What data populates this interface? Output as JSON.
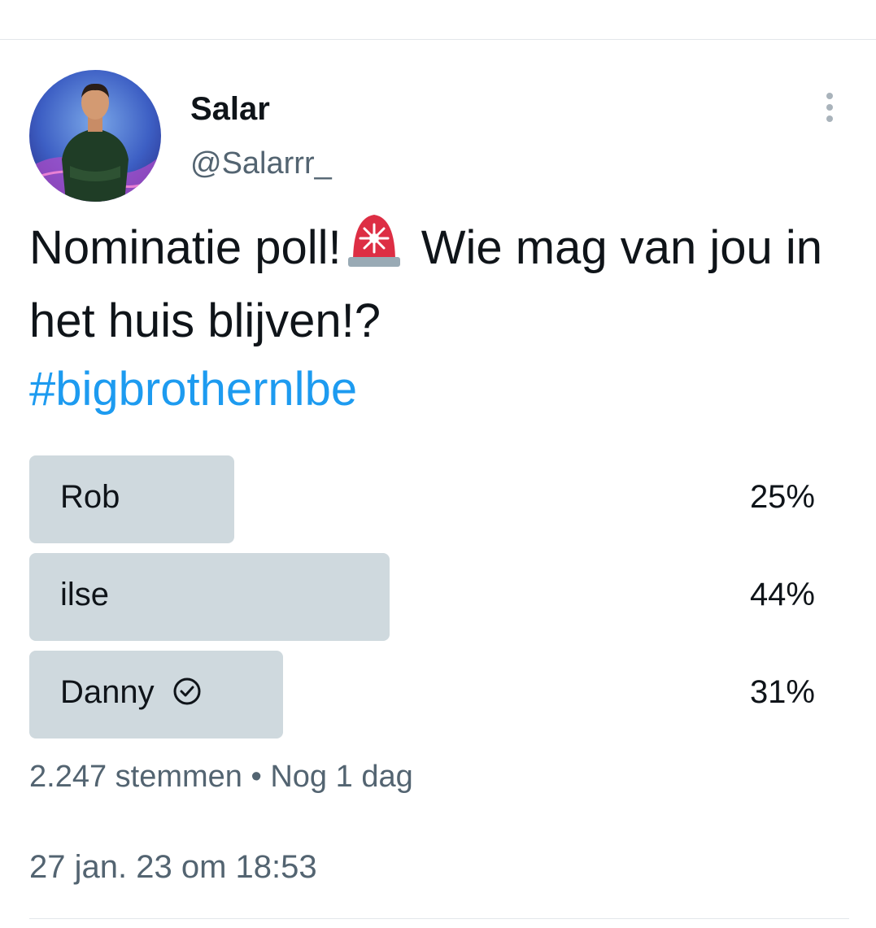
{
  "author": {
    "name": "Salar",
    "handle": "@Salarrr_"
  },
  "tweet": {
    "text_part1": "Nominatie poll!",
    "text_part2": " Wie mag van jou in het huis blijven!?",
    "hashtag": "#bigbrothernlbe",
    "emoji_icon": "police-siren-icon"
  },
  "poll": {
    "options": [
      {
        "label": "Rob",
        "percent_text": "25%",
        "percent": 25,
        "selected": false
      },
      {
        "label": "ilse",
        "percent_text": "44%",
        "percent": 44,
        "selected": false
      },
      {
        "label": "Danny",
        "percent_text": "31%",
        "percent": 31,
        "selected": true
      }
    ],
    "votes": "2.247 stemmen",
    "separator": "•",
    "time_left": "Nog 1 dag"
  },
  "timestamp": "27 jan. 23 om 18:53",
  "colors": {
    "hashtag": "#1d9bf0",
    "poll_fill": "#cfd9de",
    "muted_text": "#536471"
  }
}
